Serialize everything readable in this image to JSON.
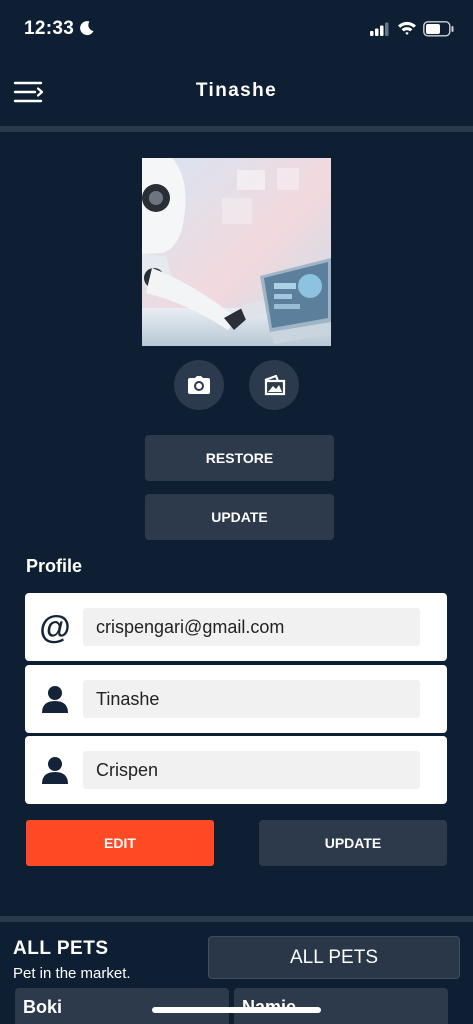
{
  "status": {
    "time": "12:33"
  },
  "appbar": {
    "title": "Tinashe"
  },
  "photo_actions": {
    "camera": "camera-icon",
    "gallery": "gallery-icon"
  },
  "buttons": {
    "restore": "RESTORE",
    "update_photo": "UPDATE"
  },
  "profile": {
    "title": "Profile",
    "email": "crispengari@gmail.com",
    "first_name": "Tinashe",
    "last_name": "Crispen",
    "edit_label": "EDIT",
    "update_label": "UPDATE"
  },
  "pets": {
    "title": "ALL PETS",
    "subtitle": "Pet in the market.",
    "button_label": "ALL PETS",
    "items": [
      {
        "name": "Boki"
      },
      {
        "name": "Namie"
      }
    ]
  },
  "colors": {
    "background": "#0f1f33",
    "accent": "#ff4a24",
    "button": "#2c3a4c",
    "card": "#ffffff"
  }
}
